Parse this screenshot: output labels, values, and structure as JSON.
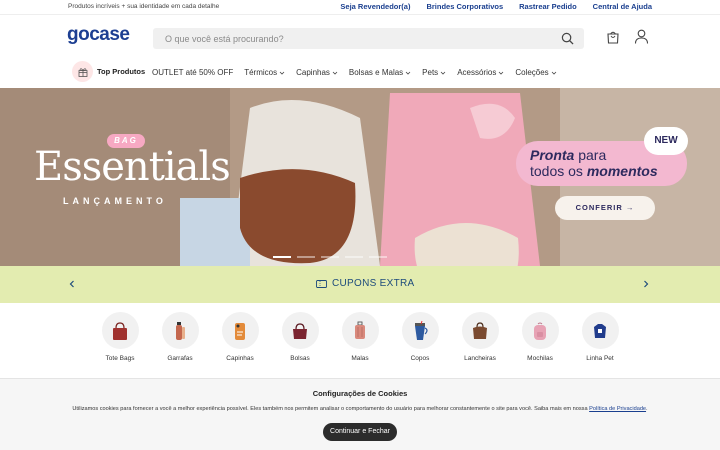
{
  "topbar": {
    "tagline": "Produtos incríveis + sua identidade em cada detalhe",
    "links": [
      "Seja Revendedor(a)",
      "Brindes Corporativos",
      "Rastrear Pedido",
      "Central de Ajuda"
    ]
  },
  "header": {
    "logo": "gocase",
    "search_placeholder": "O que você está procurando?"
  },
  "nav": {
    "top_products": "Top Produtos",
    "items": [
      "OUTLET até 50% OFF",
      "Térmicos",
      "Capinhas",
      "Bolsas e Malas",
      "Pets",
      "Acessórios",
      "Coleções"
    ]
  },
  "hero": {
    "badge": "BAG",
    "title": "Essentials",
    "subtitle": "LANÇAMENTO",
    "new_badge": "NEW",
    "promo_line1_bold": "Pronta",
    "promo_line1_rest": " para",
    "promo_line2_rest": "todos os ",
    "promo_line2_bold": "momentos",
    "cta": "CONFERIR →"
  },
  "coupon": {
    "label": "CUPONS EXTRA"
  },
  "categories": [
    {
      "name": "Tote Bags",
      "color": "#a0322f"
    },
    {
      "name": "Garrafas",
      "color": "#c4674e"
    },
    {
      "name": "Capinhas",
      "color": "#e38b3a"
    },
    {
      "name": "Bolsas",
      "color": "#7b2430"
    },
    {
      "name": "Malas",
      "color": "#d9897c"
    },
    {
      "name": "Copos",
      "color": "#2d5aa0"
    },
    {
      "name": "Lancheiras",
      "color": "#7a4a30"
    },
    {
      "name": "Mochilas",
      "color": "#e7a2b4"
    },
    {
      "name": "Linha Pet",
      "color": "#213c8c"
    }
  ],
  "cookie": {
    "title": "Configurações de Cookies",
    "text": "Utilizamos cookies para fornecer a você a melhor experiência possível. Eles também nos permitem analisar o comportamento do usuário para melhorar constantemente o site para você. Saiba mais em nossa ",
    "link": "Política de Privacidade",
    "button": "Continuar e Fechar"
  }
}
